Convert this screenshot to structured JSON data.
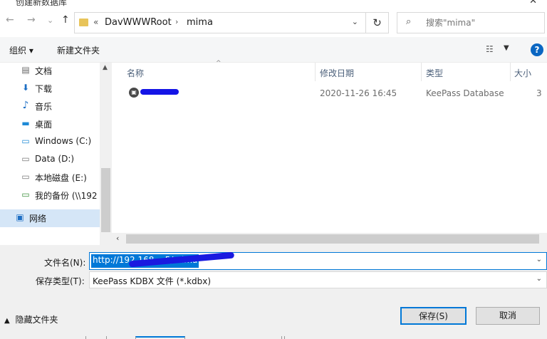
{
  "window": {
    "title": "创建新数据库",
    "close_glyph": "✕"
  },
  "nav": {
    "back_glyph": "←",
    "forward_glyph": "→",
    "recent_glyph": "⌄",
    "up_glyph": "↑",
    "breadcrumb_sep": "«",
    "breadcrumb": [
      "DavWWWRoot",
      "mima"
    ],
    "breadcrumb_arrow": "›",
    "dropdown_glyph": "⌄",
    "refresh_glyph": "↻",
    "search_placeholder": "搜索\"mima\""
  },
  "toolbar": {
    "organize_label": "组织 ▾",
    "new_folder_label": "新建文件夹",
    "view_glyph": "☷",
    "view_dropdown_glyph": "▼",
    "help_glyph": "?"
  },
  "sidebar": {
    "items": [
      {
        "icon": "documents-icon",
        "glyph": "▤",
        "label": "文档"
      },
      {
        "icon": "download-icon",
        "glyph": "⬇",
        "label": "下载"
      },
      {
        "icon": "music-icon",
        "glyph": "♪",
        "label": "音乐"
      },
      {
        "icon": "desktop-icon",
        "glyph": "▬",
        "label": "桌面"
      },
      {
        "icon": "windows-drive-icon",
        "glyph": "▭",
        "label": "Windows (C:)"
      },
      {
        "icon": "drive-icon",
        "glyph": "▭",
        "label": "Data (D:)"
      },
      {
        "icon": "drive-icon",
        "glyph": "▭",
        "label": "本地磁盘 (E:)"
      },
      {
        "icon": "network-drive-icon",
        "glyph": "▭",
        "label": "我的备份 (\\\\192"
      },
      {
        "icon": "network-icon",
        "glyph": "▣",
        "label": "网络"
      }
    ]
  },
  "filelist": {
    "columns": [
      "名称",
      "修改日期",
      "类型",
      "大小"
    ],
    "sort_glyph": "^",
    "rows": [
      {
        "date": "2020-11-26 16:45",
        "type": "KeePass Database",
        "size": "3"
      }
    ]
  },
  "form": {
    "filename_label": "文件名(N):",
    "filename_value": "http://192.168.     .   5/mima",
    "filetype_label": "保存类型(T):",
    "filetype_value": "KeePass KDBX 文件 (*.kdbx)",
    "hide_folders_label": "隐藏文件夹",
    "save_label": "保存(S)",
    "cancel_label": "取消"
  }
}
